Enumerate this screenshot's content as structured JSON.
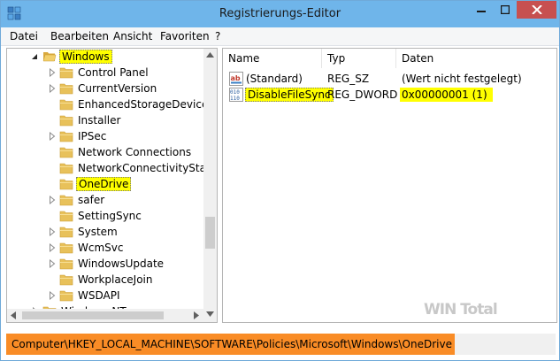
{
  "window": {
    "title": "Registrierungs-Editor"
  },
  "menu": [
    {
      "label": "Datei"
    },
    {
      "label": "Bearbeiten"
    },
    {
      "label": "Ansicht"
    },
    {
      "label": "Favoriten"
    },
    {
      "label": "?"
    }
  ],
  "tree": {
    "parent": {
      "label": "Windows",
      "state": "expanded",
      "highlighted": true
    },
    "children": [
      {
        "label": "Control Panel"
      },
      {
        "label": "CurrentVersion"
      },
      {
        "label": "EnhancedStorageDevices"
      },
      {
        "label": "Installer"
      },
      {
        "label": "IPSec"
      },
      {
        "label": "Network Connections"
      },
      {
        "label": "NetworkConnectivityStatus"
      },
      {
        "label": "OneDrive",
        "selected": true,
        "highlighted": true
      },
      {
        "label": "safer"
      },
      {
        "label": "SettingSync"
      },
      {
        "label": "System"
      },
      {
        "label": "WcmSvc"
      },
      {
        "label": "WindowsUpdate"
      },
      {
        "label": "WorkplaceJoin"
      },
      {
        "label": "WSDAPI"
      }
    ],
    "sibling": {
      "label": "Windows NT"
    }
  },
  "list": {
    "columns": [
      {
        "label": "Name"
      },
      {
        "label": "Typ"
      },
      {
        "label": "Daten"
      }
    ],
    "rows": [
      {
        "name": "(Standard)",
        "type": "REG_SZ",
        "data": "(Wert nicht festgelegt)",
        "icon": "string-value-icon"
      },
      {
        "name": "DisableFileSync",
        "type": "REG_DWORD",
        "data": "0x00000001 (1)",
        "icon": "binary-value-icon",
        "highlighted": true
      }
    ]
  },
  "status": {
    "path": "Computer\\HKEY_LOCAL_MACHINE\\SOFTWARE\\Policies\\Microsoft\\Windows\\OneDrive"
  },
  "watermark": {
    "text": "WIN Total"
  },
  "colors": {
    "titlebar": "#6fb5ea",
    "close_button": "#c75050",
    "highlight": "#ffff00",
    "status_highlight": "#f98c26",
    "folder": "#e8c15a"
  }
}
